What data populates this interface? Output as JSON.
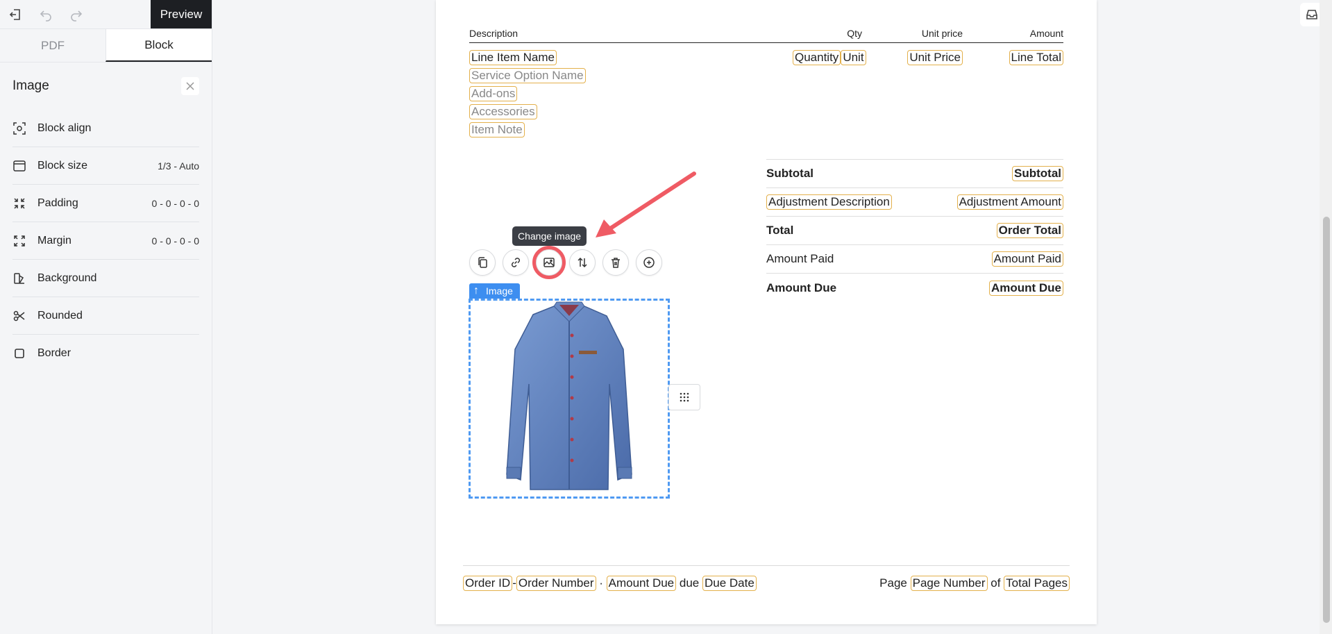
{
  "header": {
    "preview_label": "Preview"
  },
  "tabs": [
    {
      "label": "PDF"
    },
    {
      "label": "Block"
    }
  ],
  "panel": {
    "title": "Image",
    "properties": [
      {
        "label": "Block align",
        "value": ""
      },
      {
        "label": "Block size",
        "value": "1/3 - Auto"
      },
      {
        "label": "Padding",
        "value": "0 - 0 - 0 - 0"
      },
      {
        "label": "Margin",
        "value": "0 - 0 - 0 - 0"
      },
      {
        "label": "Background",
        "value": ""
      },
      {
        "label": "Rounded",
        "value": ""
      },
      {
        "label": "Border",
        "value": ""
      }
    ]
  },
  "items_table": {
    "headers": {
      "description": "Description",
      "qty": "Qty",
      "unit_price": "Unit price",
      "amount": "Amount"
    },
    "row": {
      "name": "Line Item Name",
      "service_option": "Service Option Name",
      "addons": "Add-ons",
      "accessories": "Accessories",
      "note": "Item Note",
      "quantity": "Quantity",
      "unit": "Unit",
      "unit_price": "Unit Price",
      "line_total": "Line Total"
    }
  },
  "totals": [
    {
      "label": "Subtotal",
      "value": "Subtotal"
    },
    {
      "label": "Adjustment Description",
      "value": "Adjustment Amount"
    },
    {
      "label": "Total",
      "value": "Order Total"
    },
    {
      "label": "Amount Paid",
      "value": "Amount Paid"
    },
    {
      "label": "Amount Due",
      "value": "Amount Due"
    }
  ],
  "image_toolbar": {
    "tooltip": "Change image",
    "block_label": "Image"
  },
  "footer": {
    "order_id": "Order ID",
    "separator": "-",
    "order_number": "Order Number",
    "dot": "·",
    "amount_due": "Amount Due",
    "due_text": "due",
    "due_date": "Due Date",
    "page_text": "Page",
    "page_number": "Page Number",
    "of_text": "of",
    "total_pages": "Total Pages"
  },
  "colors": {
    "accent": "#3d8ef0",
    "chip_border": "#e3b04b",
    "highlight": "#ef5b64",
    "tooltip_bg": "#3b3e45"
  }
}
